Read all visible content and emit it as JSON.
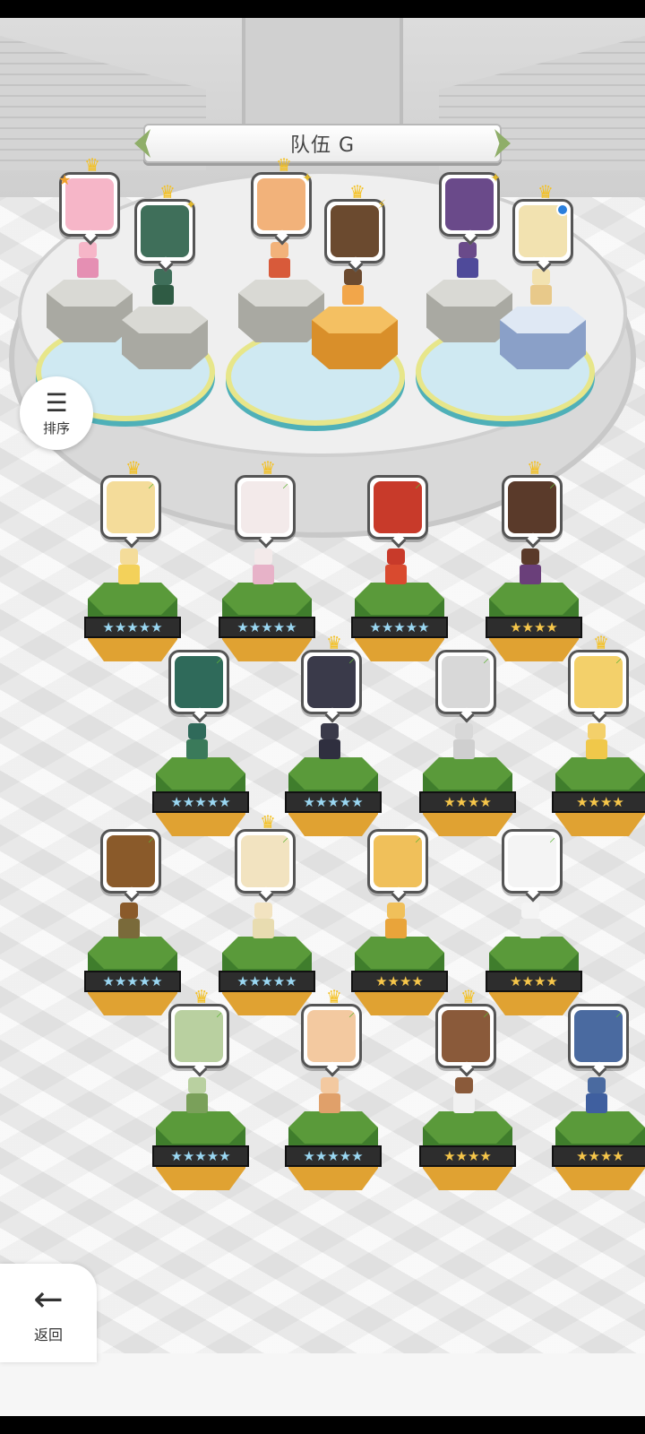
{
  "team": {
    "title": "队伍 G"
  },
  "buttons": {
    "sort_label": "排序",
    "back_label": "返回"
  },
  "icons": {
    "sort": "sort-icon",
    "back": "back-arrow-icon",
    "crown": "crown-icon",
    "leaf": "leaf-icon"
  },
  "colors": {
    "four_star": "#f6c64a",
    "five_star": "#9ad7f2",
    "grass": "#5a9a3a",
    "crown": "#f4c020"
  },
  "formation": [
    {
      "name": "pink-haired-captain",
      "face": "#f6b6c8",
      "sprite": "#e58fb3",
      "crown": true,
      "badge": "star",
      "pedestal": "stone"
    },
    {
      "name": "green-haired-girl",
      "face": "#3f6f5a",
      "sprite": "#2f5b44",
      "crown": true,
      "badge": "spark",
      "pedestal": "stone"
    },
    {
      "name": "orange-haired-girl",
      "face": "#f2b27a",
      "sprite": "#d85a3a",
      "crown": true,
      "badge": "spark",
      "pedestal": "stone"
    },
    {
      "name": "glasses-boy",
      "face": "#6b4a2f",
      "sprite": "#f2a64a",
      "crown": true,
      "badge": "bolt",
      "pedestal": "gold"
    },
    {
      "name": "dark-skinned-girl",
      "face": "#6a4a8a",
      "sprite": "#4f4a9a",
      "crown": false,
      "badge": "spark",
      "pedestal": "stone"
    },
    {
      "name": "white-dragon",
      "face": "#f2e2b0",
      "sprite": "#e8c98a",
      "crown": true,
      "badge": "dot",
      "pedestal": "blue"
    }
  ],
  "roster": [
    {
      "name": "blonde-elf",
      "face": "#f4dc9a",
      "sprite": "#f3d15a",
      "crown": true,
      "stars": 5
    },
    {
      "name": "white-haired-girl",
      "face": "#f3eaea",
      "sprite": "#e7b2c8",
      "crown": true,
      "stars": 5
    },
    {
      "name": "red-dragon-knight",
      "face": "#c83a2a",
      "sprite": "#d94a2f",
      "crown": false,
      "stars": 5
    },
    {
      "name": "brown-haired-ninja",
      "face": "#5a3a2a",
      "sprite": "#6a3f7a",
      "crown": true,
      "stars": 4
    },
    {
      "name": "green-haired-mage",
      "face": "#2f6a5a",
      "sprite": "#3a7a5a",
      "crown": false,
      "stars": 5
    },
    {
      "name": "dark-armored-knight",
      "face": "#3a3a4a",
      "sprite": "#2f2f3f",
      "crown": true,
      "stars": 5
    },
    {
      "name": "white-tiger",
      "face": "#d8d8d8",
      "sprite": "#cfcfcf",
      "crown": false,
      "stars": 4
    },
    {
      "name": "blonde-angry-girl",
      "face": "#f3d06a",
      "sprite": "#f0c84a",
      "crown": true,
      "stars": 4
    },
    {
      "name": "tan-warrior",
      "face": "#8a5a2a",
      "sprite": "#7a6a3a",
      "crown": false,
      "stars": 5
    },
    {
      "name": "cream-haired-priestess",
      "face": "#f2e3c0",
      "sprite": "#e8dcb0",
      "crown": true,
      "stars": 5
    },
    {
      "name": "cat-boy",
      "face": "#f0c05a",
      "sprite": "#e9a43a",
      "crown": false,
      "stars": 4
    },
    {
      "name": "white-goat",
      "face": "#f4f4f4",
      "sprite": "#e9e9e9",
      "crown": false,
      "stars": 4
    },
    {
      "name": "snake-hat-girl",
      "face": "#b9d0a0",
      "sprite": "#7aa05a",
      "crown": true,
      "stars": 5
    },
    {
      "name": "cowgirl",
      "face": "#f3c9a0",
      "sprite": "#e0a06a",
      "crown": true,
      "stars": 5
    },
    {
      "name": "white-haired-tan-boy",
      "face": "#8a5a3a",
      "sprite": "#f1f1f1",
      "crown": true,
      "stars": 4
    },
    {
      "name": "pilot-animal",
      "face": "#4a6aa0",
      "sprite": "#3f5f9f",
      "crown": false,
      "stars": 4
    }
  ]
}
